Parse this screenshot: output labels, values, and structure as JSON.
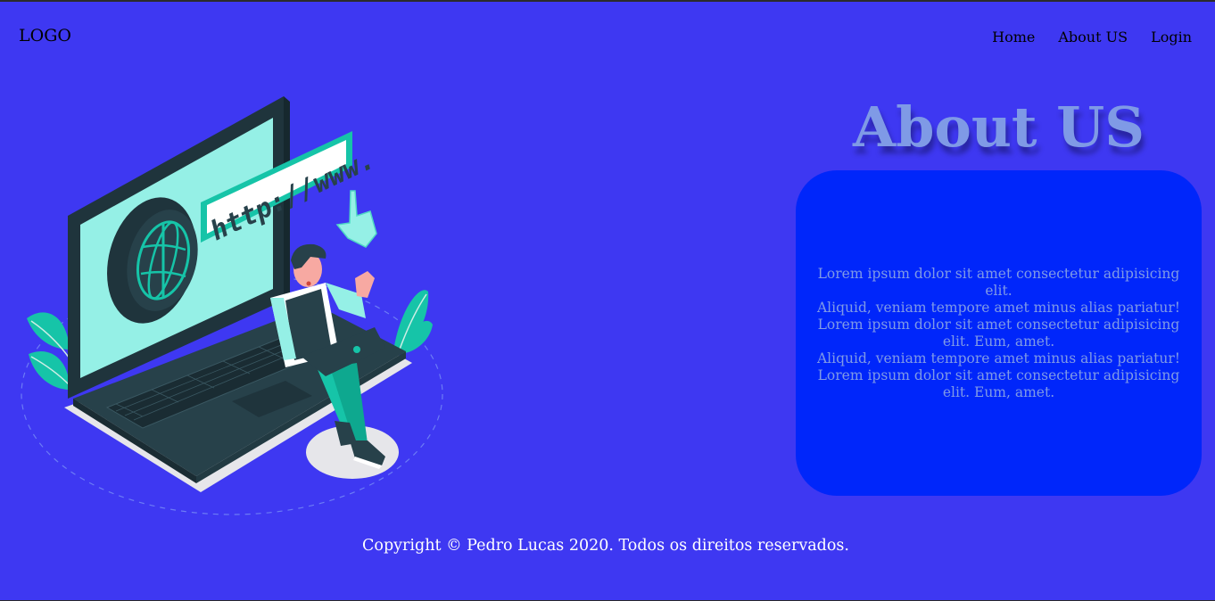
{
  "header": {
    "logo": "LOGO",
    "nav": [
      "Home",
      "About US",
      "Login"
    ]
  },
  "illustration": {
    "url_label": "http://www."
  },
  "about": {
    "title": "About US",
    "body": "Lorem ipsum dolor sit amet consectetur adipisicing elit.\nAliquid, veniam tempore amet minus alias pariatur! Lorem ipsum dolor sit amet consectetur adipisicing elit. Eum, amet.\nAliquid, veniam tempore amet minus alias pariatur! Lorem ipsum dolor sit amet consectetur adipisicing elit. Eum, amet."
  },
  "footer": {
    "copyright": "Copyright © Pedro Lucas 2020. Todos os direitos reservados."
  },
  "colors": {
    "background": "#3e38f2",
    "card": "#0026fa",
    "accent_text": "#7f9ae6",
    "illustration_teal": "#16c4a8",
    "illustration_dark": "#27414a"
  }
}
